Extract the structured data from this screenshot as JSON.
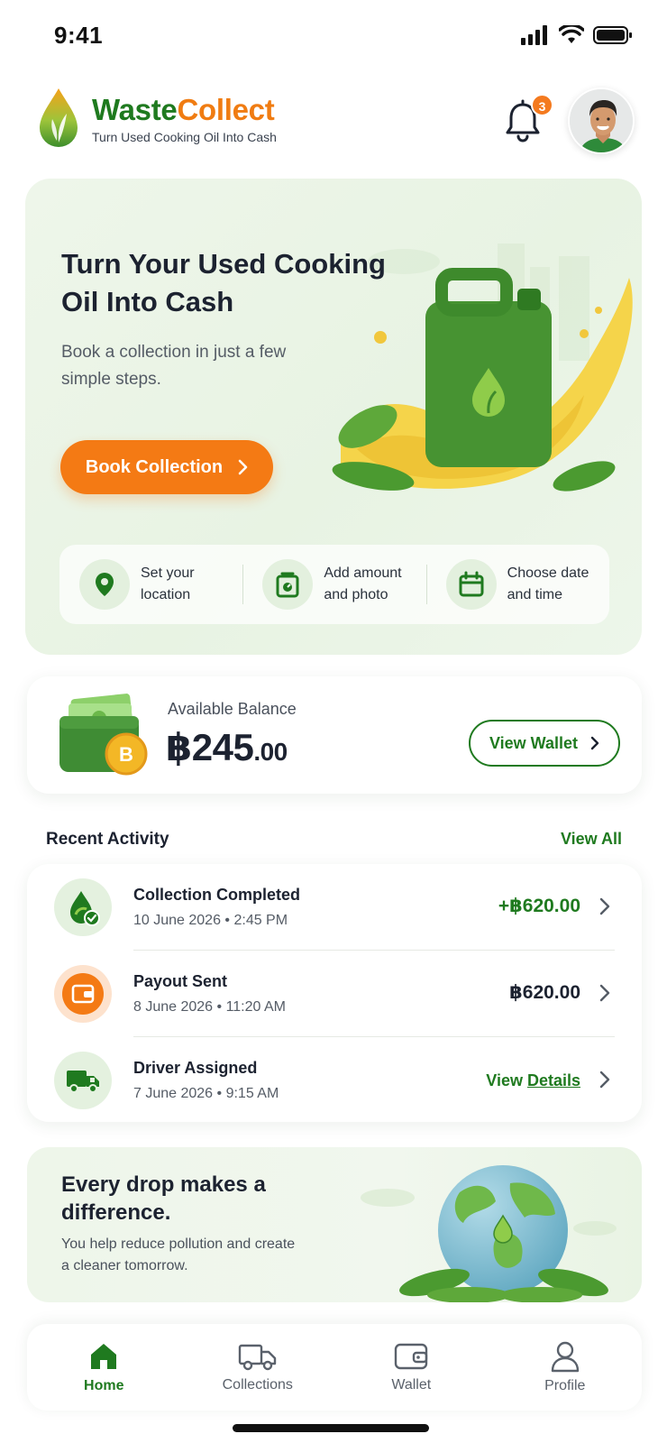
{
  "status_bar": {
    "time": "9:41"
  },
  "header": {
    "brand_part1": "Waste",
    "brand_part2": "Collect",
    "tagline": "Turn Used Cooking Oil Into Cash",
    "notification_count": "3"
  },
  "hero": {
    "title": "Turn Your Used Cooking Oil Into Cash",
    "subtitle": "Book a collection in just a few simple steps.",
    "cta_label": "Book Collection",
    "steps": [
      {
        "label": "Set your location",
        "icon": "location-pin-icon"
      },
      {
        "label": "Add amount and photo",
        "icon": "scale-icon"
      },
      {
        "label": "Choose date and time",
        "icon": "calendar-icon"
      }
    ]
  },
  "wallet": {
    "label": "Available Balance",
    "balance_main": "฿245",
    "balance_cents": ".00",
    "button_label": "View Wallet"
  },
  "activity": {
    "section_title": "Recent Activity",
    "view_all": "View All",
    "items": [
      {
        "title": "Collection Completed",
        "date": "10 June 2026  •  2:45 PM",
        "amount": "+฿620.00",
        "icon": "oil-drop-check-icon"
      },
      {
        "title": "Payout Sent",
        "date": "8 June 2026  •  11:20 AM",
        "amount": "฿620.00",
        "icon": "wallet-icon"
      },
      {
        "title": "Driver Assigned",
        "date": "7 June 2026  •  9:15 AM",
        "action_prefix": "View ",
        "action_link": "Details",
        "icon": "truck-icon"
      }
    ]
  },
  "eco": {
    "title": "Every drop makes a difference.",
    "subtitle": "You help reduce pollution and create a cleaner tomorrow."
  },
  "nav": {
    "items": [
      {
        "label": "Home",
        "icon": "home-icon",
        "active": true
      },
      {
        "label": "Collections",
        "icon": "truck-icon",
        "active": false
      },
      {
        "label": "Wallet",
        "icon": "wallet-icon",
        "active": false
      },
      {
        "label": "Profile",
        "icon": "profile-icon",
        "active": false
      }
    ]
  },
  "colors": {
    "brand_green": "#1f7a1f",
    "brand_orange": "#f47a14",
    "hero_bg": "#eaf4e6",
    "text_dark": "#1c2230"
  }
}
